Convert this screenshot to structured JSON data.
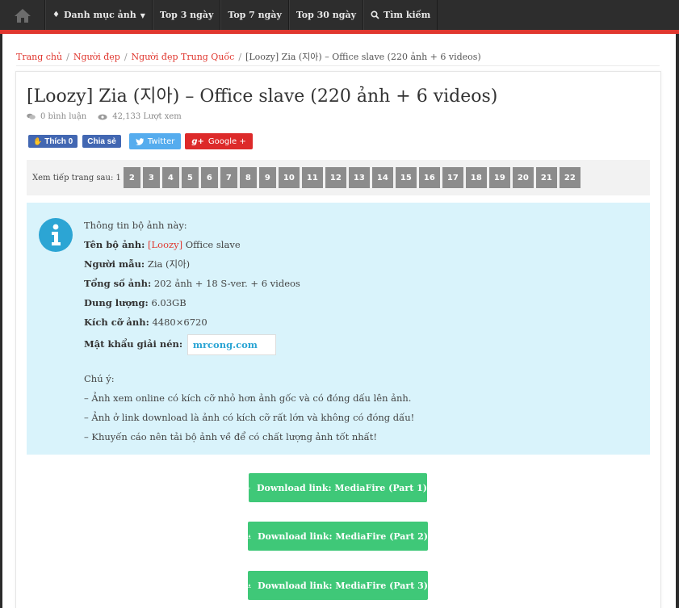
{
  "nav": {
    "items": [
      {
        "label": "Danh mục ảnh",
        "icon": "diamond-icon",
        "dropdown": true
      },
      {
        "label": "Top 3 ngày"
      },
      {
        "label": "Top 7 ngày"
      },
      {
        "label": "Top 30 ngày"
      },
      {
        "label": "Tìm kiếm",
        "icon": "search-icon"
      }
    ]
  },
  "breadcrumb": [
    "Trang chủ",
    "Người đẹp",
    "Người đẹp Trung Quốc",
    "[Loozy] Zia (지아) – Office slave (220 ảnh + 6 videos)"
  ],
  "post": {
    "title": "[Loozy] Zia (지아) – Office slave (220 ảnh + 6 videos)",
    "comments": "0 bình luận",
    "views": "42,133 Lượt xem"
  },
  "share": {
    "fb_like": "Thích 0",
    "fb_share": "Chia sẻ",
    "twitter": "Twitter",
    "google": "Google +"
  },
  "pager": {
    "label": "Xem tiếp trang sau: 1",
    "pages": [
      "2",
      "3",
      "4",
      "5",
      "6",
      "7",
      "8",
      "9",
      "10",
      "11",
      "12",
      "13",
      "14",
      "15",
      "16",
      "17",
      "18",
      "19",
      "20",
      "21",
      "22"
    ]
  },
  "info": {
    "heading": "Thông tin bộ ảnh này:",
    "set_label": "Tên bộ ảnh:",
    "set_brand": "[Loozy]",
    "set_name": "Office slave",
    "model_label": "Người mẫu:",
    "model": "Zia (지아)",
    "count_label": "Tổng số ảnh:",
    "count": "202 ảnh + 18 S-ver. + 6 videos",
    "size_label": "Dung lượng:",
    "size": "6.03GB",
    "dims_label": "Kích cỡ ảnh:",
    "dims": "4480×6720",
    "pw_label": "Mật khẩu giải nén:",
    "pw": "mrcong.com",
    "note_heading": "Chú ý:",
    "note1": "– Ảnh xem online có kích cỡ nhỏ hơn ảnh gốc và có đóng dấu lên ảnh.",
    "note2": "– Ảnh ở link download là ảnh có kích cỡ rất lớn và không có đóng dấu!",
    "note3": "– Khuyến cáo nên tải bộ ảnh về để có chất lượng ảnh tốt nhất!"
  },
  "downloads": [
    "Download link: MediaFire (Part 1)",
    "Download link: MediaFire (Part 2)",
    "Download link: MediaFire (Part 3)"
  ],
  "colors": {
    "accent": "#e0372f",
    "download": "#3fc878",
    "info_bg": "#d9f3fb",
    "info_icon": "#2ca5d4"
  }
}
